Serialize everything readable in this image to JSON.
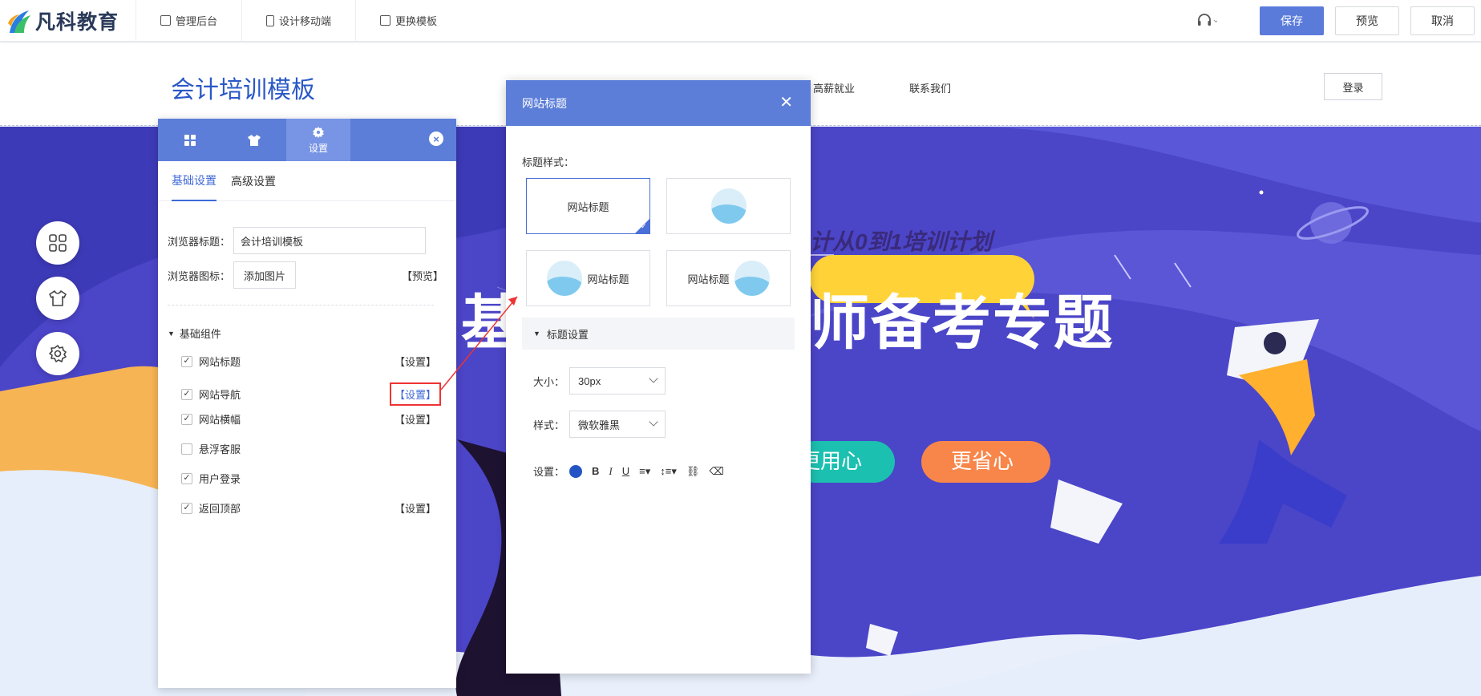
{
  "app": {
    "logo_text": "凡科教育",
    "nav": [
      {
        "label": "管理后台",
        "icon": "chart-icon"
      },
      {
        "label": "设计移动端",
        "icon": "mobile-icon"
      },
      {
        "label": "更换模板",
        "icon": "template-icon"
      }
    ],
    "buttons": {
      "save": "保存",
      "preview": "预览",
      "cancel": "取消"
    },
    "accent": "#5b7bdb"
  },
  "site": {
    "title": "会计培训模板",
    "nav": [
      "高薪就业",
      "联系我们"
    ],
    "login": "登录"
  },
  "banner": {
    "tagline": "计从0到1培训计划",
    "headline_left": "基",
    "headline": "师备考专题",
    "pill1": "更用心",
    "pill2": "更省心"
  },
  "panel": {
    "tabs": [
      {
        "icon": "grid-icon",
        "label": ""
      },
      {
        "icon": "shirt-icon",
        "label": ""
      },
      {
        "icon": "gear-icon",
        "label": "设置"
      }
    ],
    "close": "×",
    "subtabs": [
      "基础设置",
      "高级设置"
    ],
    "browser_title_label": "浏览器标题：",
    "browser_title_value": "会计培训模板",
    "browser_icon_label": "浏览器图标：",
    "add_image": "添加图片",
    "preview_link": "【预览】",
    "group": "基础组件",
    "components": [
      {
        "label": "网站标题",
        "checked": true,
        "setting": "【设置】"
      },
      {
        "label": "网站导航",
        "checked": true,
        "setting": "【设置】"
      },
      {
        "label": "网站横幅",
        "checked": true,
        "setting": "【设置】"
      },
      {
        "label": "悬浮客服",
        "checked": false,
        "setting": ""
      },
      {
        "label": "用户登录",
        "checked": true,
        "setting": ""
      },
      {
        "label": "返回顶部",
        "checked": true,
        "setting": "【设置】"
      }
    ]
  },
  "dialog": {
    "title": "网站标题",
    "close": "✕",
    "style_label": "标题样式：",
    "styles": [
      "网站标题",
      "",
      "网站标题",
      "网站标题"
    ],
    "section": "标题设置",
    "size_label": "大小：",
    "size_value": "30px",
    "font_label": "样式：",
    "font_value": "微软雅黑",
    "format_label": "设置：",
    "format_color": "#2454c4"
  }
}
